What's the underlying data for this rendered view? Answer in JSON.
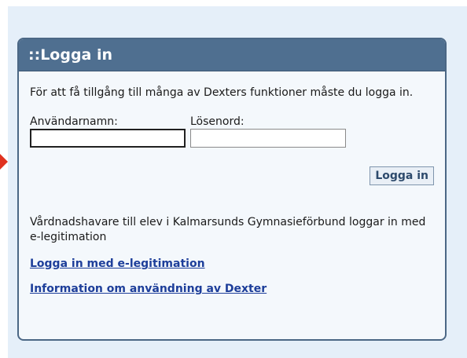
{
  "login_panel": {
    "title": "::Logga in",
    "intro_text": "För att få tillgång till många av Dexters funktioner måste du logga in.",
    "username_label": "Användarnamn:",
    "username_value": "",
    "password_label": "Lösenord:",
    "password_value": "",
    "login_button_label": "Logga in",
    "guardian_text": "Vårdnadshavare till elev i Kalmarsunds Gymnasieförbund loggar in med e-legitimation",
    "eid_link": "Logga in med e-legitimation",
    "info_link": "Information om användning av Dexter"
  },
  "colors": {
    "header_bg": "#4f6f90",
    "panel_bg": "#f4f8fc",
    "outer_bg": "#e5eff9",
    "link": "#1d3e9a",
    "indicator": "#e0321f"
  }
}
